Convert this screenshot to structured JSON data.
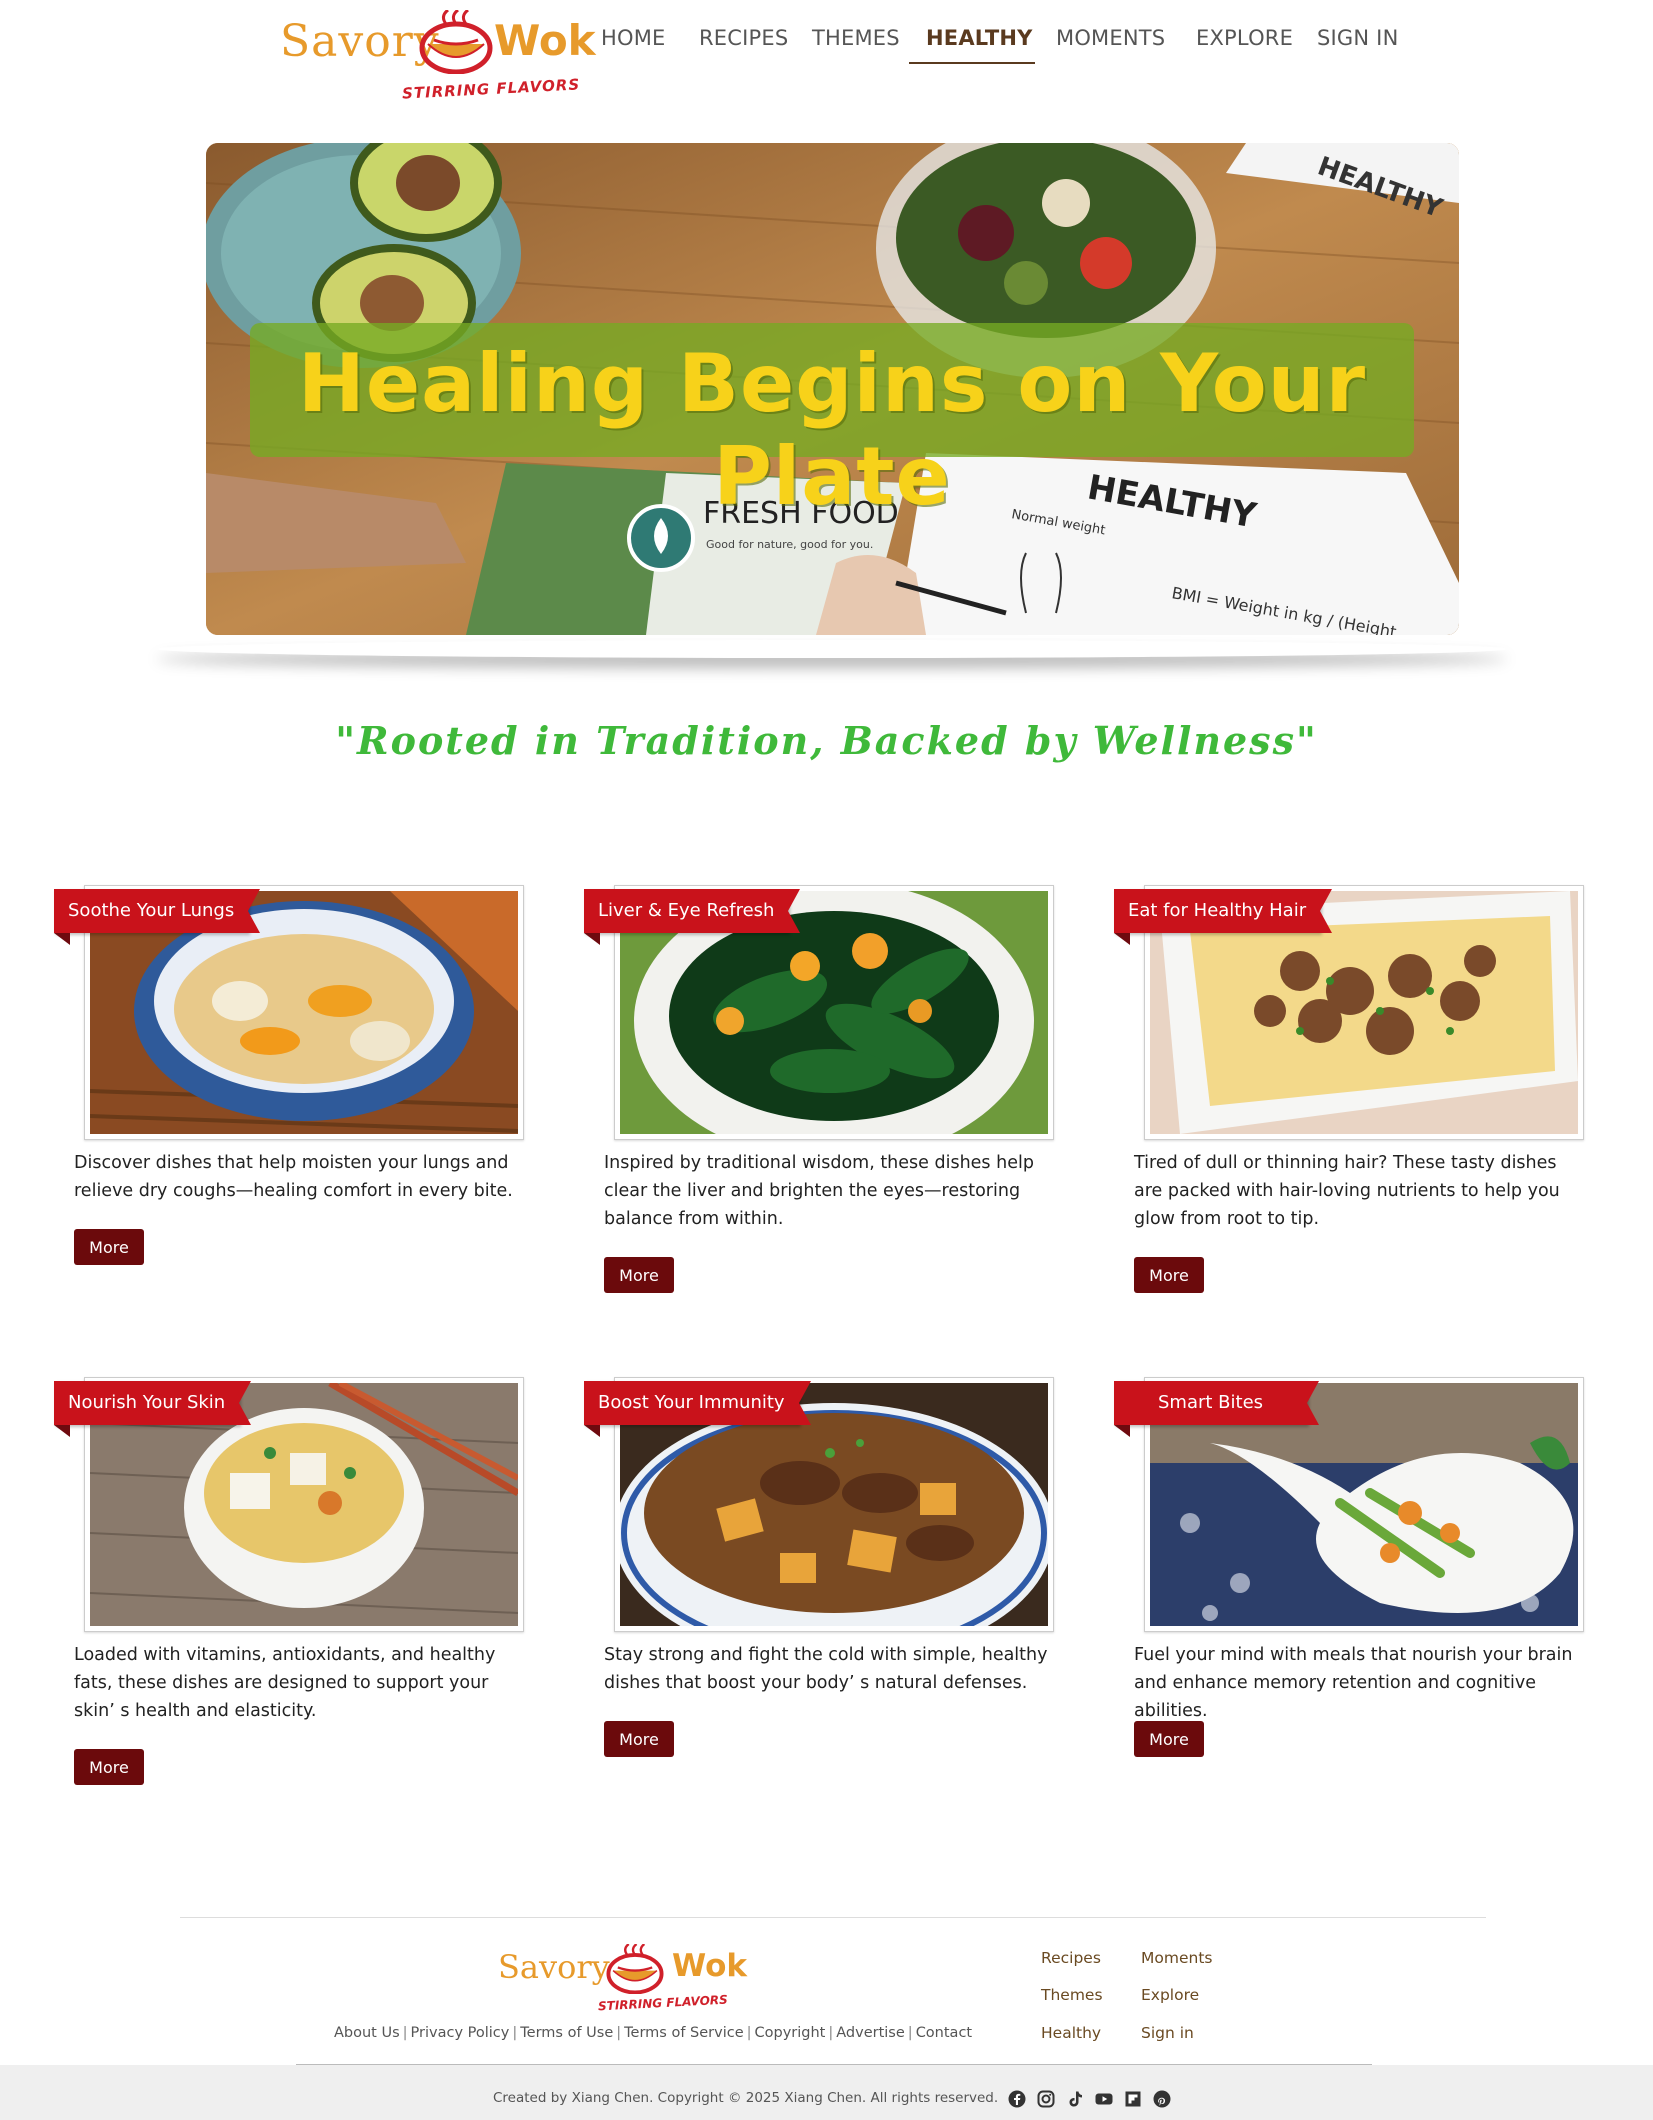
{
  "brand": {
    "word1": "Savory",
    "word2": "Wok",
    "tagline": "STIRRING FLAVORS"
  },
  "nav": {
    "items": [
      {
        "label": "HOME",
        "active": false
      },
      {
        "label": "RECIPES",
        "active": false
      },
      {
        "label": "THEMES",
        "active": false
      },
      {
        "label": "HEALTHY",
        "active": true
      },
      {
        "label": "MOMENTS",
        "active": false
      },
      {
        "label": "EXPLORE",
        "active": false
      },
      {
        "label": "SIGN IN",
        "active": false
      }
    ]
  },
  "hero": {
    "title": "Healing Begins on Your Plate",
    "card_text": "FRESH FOOD",
    "card_subtext": "Good for nature, good for you.",
    "sheet_title": "HEALTHY",
    "sheet_label": "Normal weight",
    "sheet_formula": "BMI = Weight in kg / (Height",
    "corner_text": "HEALTHY"
  },
  "slogan": "\"Rooted in Tradition, Backed by Wellness\"",
  "cards": [
    {
      "title": "Soothe Your Lungs",
      "description": "Discover dishes that help moisten your lungs and relieve dry coughs—healing comfort in every bite.",
      "button": "More",
      "image": "pear-soup-bowl"
    },
    {
      "title": "Liver & Eye Refresh",
      "description": "Inspired by traditional wisdom, these dishes help clear the liver and brighten the eyes—restoring balance from within.",
      "button": "More",
      "image": "spinach-goji"
    },
    {
      "title": "Eat for Healthy Hair",
      "description": "Tired of dull or thinning hair? These tasty dishes are packed with hair-loving nutrients to help you glow from root to tip.",
      "button": "More",
      "image": "steamed-egg-minced-pork"
    },
    {
      "title": "Nourish Your Skin",
      "description": "Loaded with vitamins, antioxidants, and healthy fats, these dishes are designed to support your skin’ s health and elasticity.",
      "button": "More",
      "image": "tofu-soup"
    },
    {
      "title": "Boost Your Immunity",
      "description": "Stay strong and fight the cold with simple, healthy dishes that boost your body’ s natural defenses.",
      "button": "More",
      "image": "braised-beef-potato"
    },
    {
      "title": "Smart Bites",
      "description": "Fuel your mind with meals that nourish your brain and enhance memory retention and cognitive abilities.",
      "button": "More",
      "image": "celery-stirfry-spoon"
    }
  ],
  "footer": {
    "legal_links": [
      "About Us",
      "Privacy Policy",
      "Terms of Use",
      "Terms of Service",
      "Copyright",
      "Advertise",
      "Contact"
    ],
    "nav_links": [
      "Recipes",
      "Themes",
      "Healthy",
      "Moments",
      "Explore",
      "Sign in"
    ],
    "copyright": "Created by Xiang Chen. Copyright © 2025 Xiang Chen. All rights reserved.",
    "social_icons": [
      "facebook-icon",
      "instagram-icon",
      "tiktok-icon",
      "youtube-icon",
      "flipboard-icon",
      "pinterest-icon"
    ]
  },
  "colors": {
    "brand_orange": "#e79a2b",
    "ribbon_red": "#c9121b",
    "button_maroon": "#6b0a0c",
    "slogan_green": "#3fb93a",
    "hero_title_yellow": "#f7d21a"
  }
}
